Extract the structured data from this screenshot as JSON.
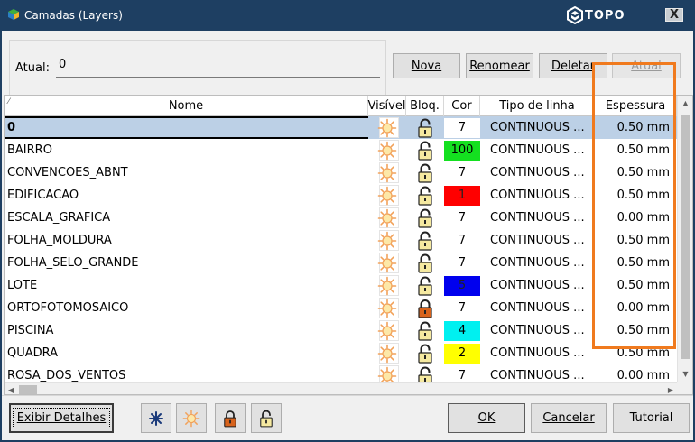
{
  "window": {
    "title": "Camadas (Layers)",
    "brand": "TOPO",
    "close_label": "X"
  },
  "atual": {
    "label": "Atual:",
    "value": "0"
  },
  "buttons": {
    "nova": "Nova",
    "renomear": "Renomear",
    "deletar": "Deletar",
    "atual": "Atual"
  },
  "columns": {
    "nome": "Nome",
    "visivel": "Visível",
    "bloq": "Bloq.",
    "cor": "Cor",
    "tipo": "Tipo de linha",
    "espessura": "Espessura"
  },
  "layers": [
    {
      "name": "0",
      "color": "7",
      "swatch": "#ffffff",
      "lock": "open",
      "tipo": "CONTINUOUS ...",
      "esp": "0.50 mm",
      "selected": true
    },
    {
      "name": "BAIRRO",
      "color": "100",
      "swatch": "#14e020",
      "lock": "open",
      "tipo": "CONTINUOUS ...",
      "esp": "0.50 mm"
    },
    {
      "name": "CONVENCOES_ABNT",
      "color": "7",
      "swatch": "#ffffff",
      "lock": "open",
      "tipo": "CONTINUOUS ...",
      "esp": "0.50 mm"
    },
    {
      "name": "EDIFICACAO",
      "color": "1",
      "swatch": "#ff0000",
      "lock": "open",
      "tipo": "CONTINUOUS ...",
      "esp": "0.50 mm"
    },
    {
      "name": "ESCALA_GRAFICA",
      "color": "7",
      "swatch": "#ffffff",
      "lock": "open",
      "tipo": "CONTINUOUS ...",
      "esp": "0.00 mm"
    },
    {
      "name": "FOLHA_MOLDURA",
      "color": "7",
      "swatch": "#ffffff",
      "lock": "open",
      "tipo": "CONTINUOUS ...",
      "esp": "0.50 mm"
    },
    {
      "name": "FOLHA_SELO_GRANDE",
      "color": "7",
      "swatch": "#ffffff",
      "lock": "open",
      "tipo": "CONTINUOUS ...",
      "esp": "0.50 mm"
    },
    {
      "name": "LOTE",
      "color": "5",
      "swatch": "#0000ee",
      "lock": "open",
      "tipo": "CONTINUOUS ...",
      "esp": "0.50 mm"
    },
    {
      "name": "ORTOFOTOMOSAICO",
      "color": "7",
      "swatch": "#ffffff",
      "lock": "closed",
      "tipo": "CONTINUOUS ...",
      "esp": "0.00 mm"
    },
    {
      "name": "PISCINA",
      "color": "4",
      "swatch": "#00f0f0",
      "lock": "open",
      "tipo": "CONTINUOUS ...",
      "esp": "0.50 mm"
    },
    {
      "name": "QUADRA",
      "color": "2",
      "swatch": "#ffff00",
      "lock": "open",
      "tipo": "CONTINUOUS ...",
      "esp": "0.50 mm"
    },
    {
      "name": "ROSA_DOS_VENTOS",
      "color": "7",
      "swatch": "#ffffff",
      "lock": "open",
      "tipo": "CONTINUOUS ...",
      "esp": "0.00 mm"
    }
  ],
  "footer": {
    "exibir": "Exibir Detalhes",
    "ok": "OK",
    "cancelar": "Cancelar",
    "tutorial": "Tutorial"
  },
  "icons": [
    "freeze-icon",
    "thaw-icon",
    "lock-all-icon",
    "unlock-all-icon"
  ]
}
